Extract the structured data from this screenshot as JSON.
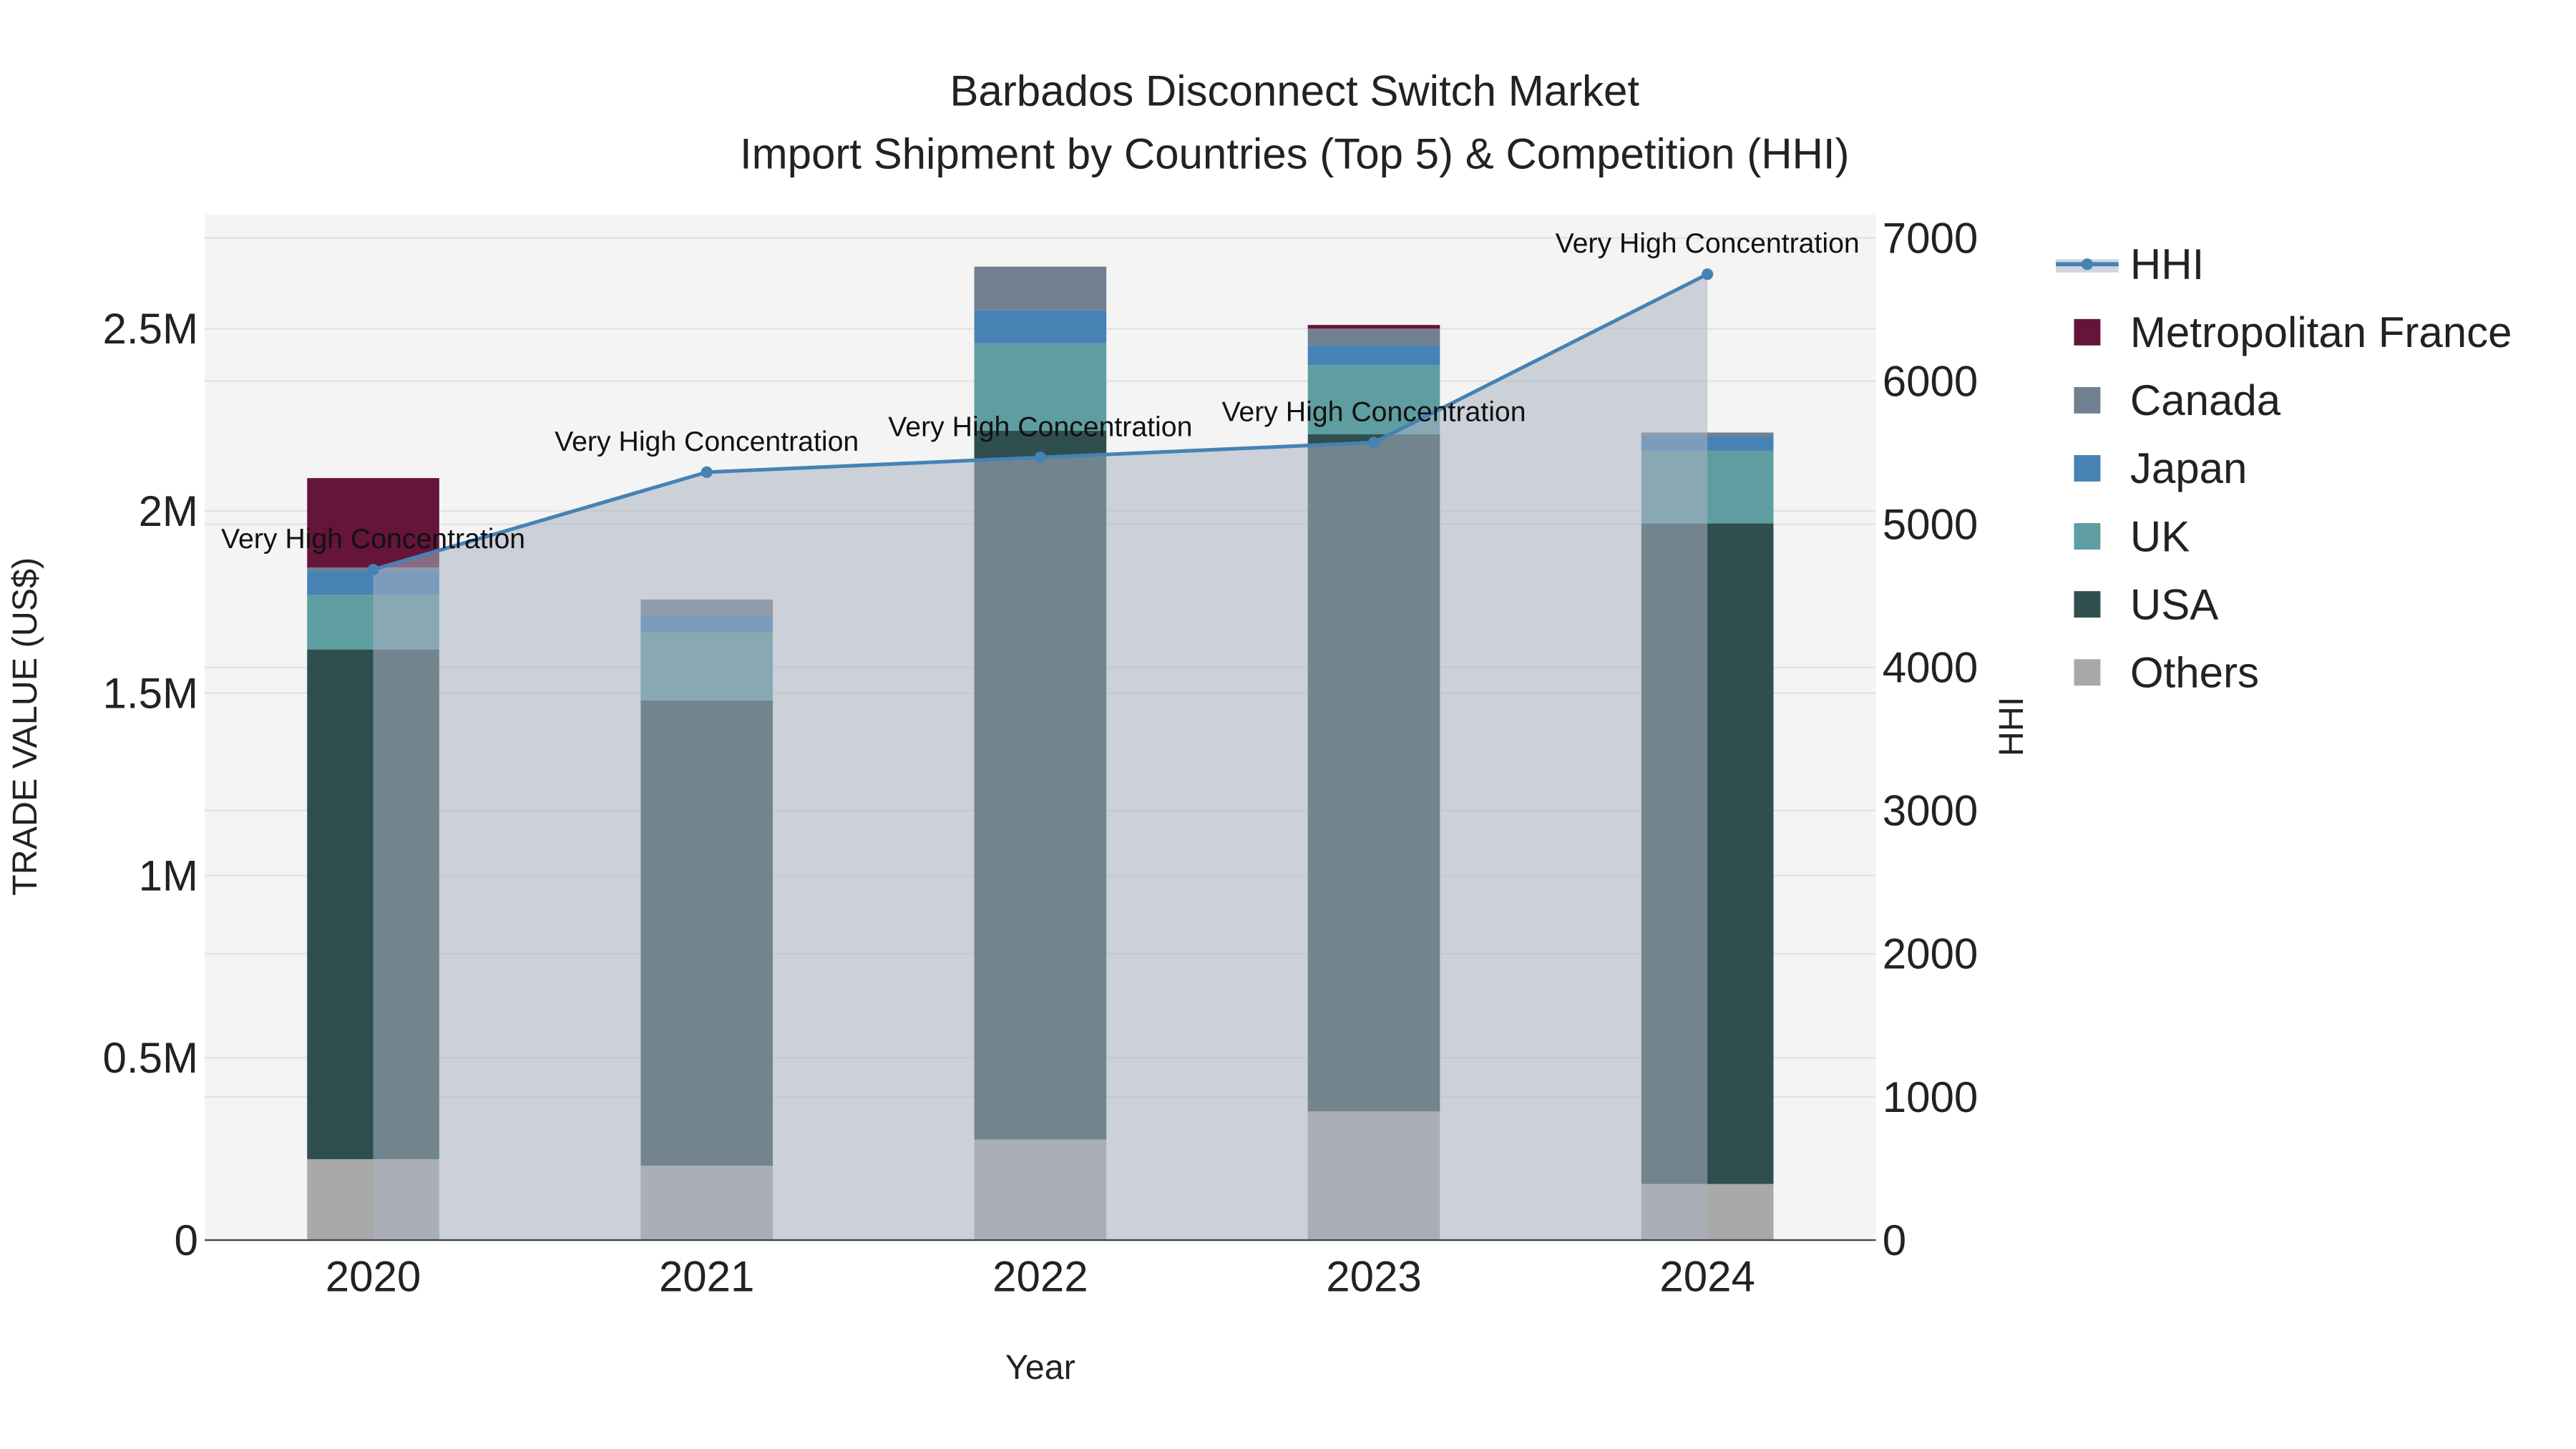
{
  "chart_data": {
    "type": "bar",
    "title": "Barbados Disconnect Switch Market",
    "subtitle": "Import Shipment by Countries (Top 5) & Competition (HHI)",
    "xlabel": "Year",
    "ylabel": "TRADE VALUE (US$)",
    "y2label": "HHI",
    "categories": [
      "2020",
      "2021",
      "2022",
      "2023",
      "2024"
    ],
    "ylim": [
      0,
      2800000
    ],
    "y2lim": [
      0,
      7150
    ],
    "yticks": [
      {
        "v": 0,
        "label": "0"
      },
      {
        "v": 500000,
        "label": "0.5M"
      },
      {
        "v": 1000000,
        "label": "1M"
      },
      {
        "v": 1500000,
        "label": "1.5M"
      },
      {
        "v": 2000000,
        "label": "2M"
      },
      {
        "v": 2500000,
        "label": "2.5M"
      }
    ],
    "y2ticks": [
      {
        "v": 0,
        "label": "0"
      },
      {
        "v": 1000,
        "label": "1000"
      },
      {
        "v": 2000,
        "label": "2000"
      },
      {
        "v": 3000,
        "label": "3000"
      },
      {
        "v": 4000,
        "label": "4000"
      },
      {
        "v": 5000,
        "label": "5000"
      },
      {
        "v": 6000,
        "label": "6000"
      },
      {
        "v": 7000,
        "label": "7000"
      }
    ],
    "stack_order": [
      "Others",
      "USA",
      "UK",
      "Japan",
      "Canada",
      "Metropolitan France"
    ],
    "series": [
      {
        "name": "Others",
        "color": "#a9a9a9",
        "values": [
          222000,
          204000,
          276000,
          353000,
          154000
        ]
      },
      {
        "name": "USA",
        "color": "#2f4f4f",
        "values": [
          1398000,
          1276000,
          1944000,
          1857000,
          1812000
        ]
      },
      {
        "name": "UK",
        "color": "#5f9ea0",
        "values": [
          150000,
          187000,
          240000,
          190000,
          199000
        ]
      },
      {
        "name": "Japan",
        "color": "#4682b4",
        "values": [
          65000,
          45000,
          90000,
          55000,
          40000
        ]
      },
      {
        "name": "Canada",
        "color": "#708090",
        "values": [
          10000,
          45000,
          120000,
          45000,
          10000
        ]
      },
      {
        "name": "Metropolitan France",
        "color": "#65143a",
        "values": [
          245000,
          0,
          0,
          10000,
          0
        ]
      }
    ],
    "hhi": {
      "name": "HHI",
      "color": "#4682b4",
      "values": [
        4683,
        5364,
        5467,
        5571,
        6747
      ],
      "annotations": [
        "Very High Concentration",
        "Very High Concentration",
        "Very High Concentration",
        "Very High Concentration",
        "Very High Concentration"
      ]
    },
    "legend": {
      "placement": "right",
      "entries": [
        "HHI",
        "Metropolitan France",
        "Canada",
        "Japan",
        "UK",
        "USA",
        "Others"
      ]
    },
    "grid": true
  }
}
